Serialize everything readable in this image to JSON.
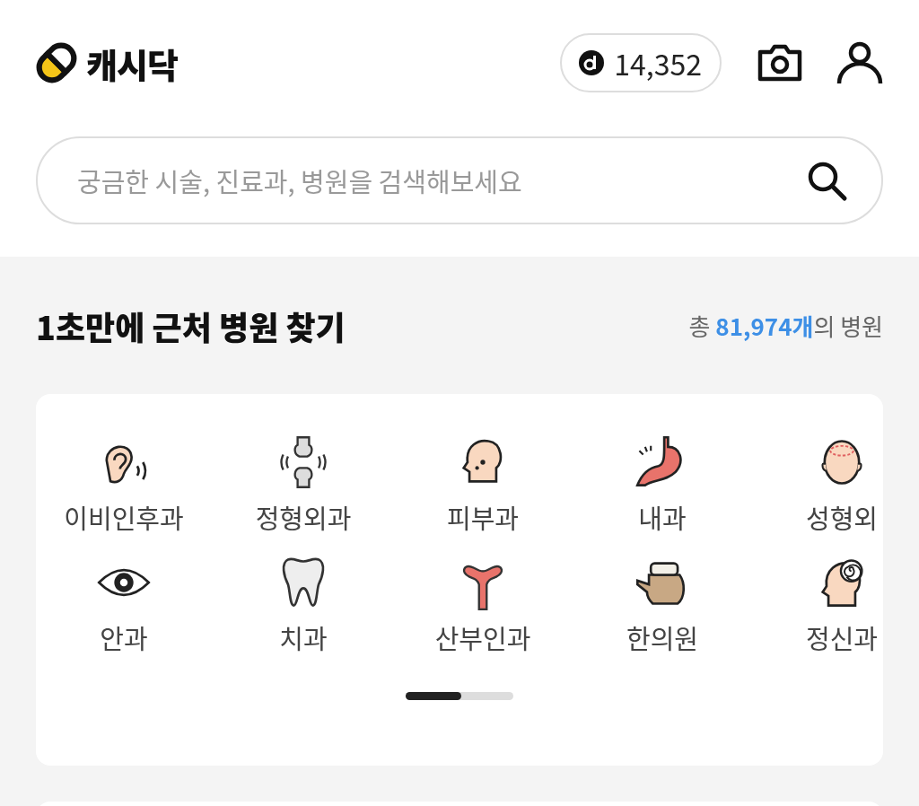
{
  "header": {
    "logo_text": "캐시닥",
    "points": "14,352"
  },
  "search": {
    "placeholder": "궁금한 시술, 진료과, 병원을 검색해보세요"
  },
  "section": {
    "title": "1초만에 근처 병원 찾기",
    "total": "총 **81,974개**의 병원"
  },
  "departments": [
    {
      "label": "이비인후과",
      "kind": "ear"
    },
    {
      "label": "정형외과",
      "kind": "joint"
    },
    {
      "label": "피부과",
      "kind": "skin"
    },
    {
      "label": "내과",
      "kind": "stomach"
    },
    {
      "label": "성형외",
      "kind": "head"
    },
    {
      "label": "안과",
      "kind": "eye"
    },
    {
      "label": "치과",
      "kind": "tooth"
    },
    {
      "label": "산부인과",
      "kind": "uterus"
    },
    {
      "label": "한의원",
      "kind": "pot"
    },
    {
      "label": "정신과",
      "kind": "mind"
    }
  ]
}
